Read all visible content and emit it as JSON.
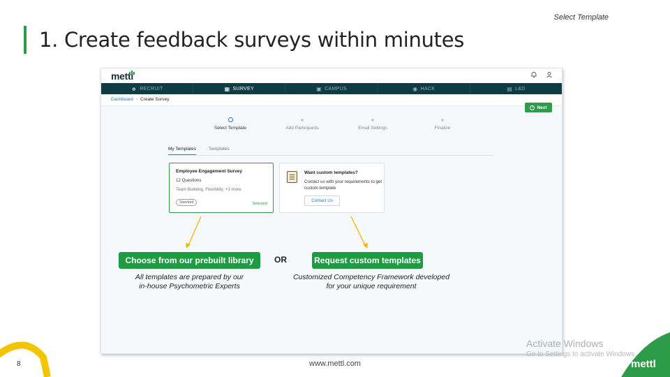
{
  "slide": {
    "top_label": "Select Template",
    "title": "1. Create feedback surveys within minutes",
    "page_number": "8",
    "footer_url": "www.mettl.com",
    "footer_logo": "mettl"
  },
  "app": {
    "logo": "mettl",
    "nav": [
      {
        "label": "RECRUIT",
        "icon": "people-icon"
      },
      {
        "label": "SURVEY",
        "icon": "clipboard-icon"
      },
      {
        "label": "CAMPUS",
        "icon": "building-icon"
      },
      {
        "label": "HACK",
        "icon": "code-icon"
      },
      {
        "label": "L&D",
        "icon": "book-icon"
      }
    ],
    "breadcrumb": {
      "root": "Dashboard",
      "current": "Create Survey"
    },
    "next_label": "Next",
    "steps": [
      "Select Template",
      "Add Participants",
      "Email Settings",
      "Finalize"
    ],
    "tabs": [
      "My Templates",
      "Templates"
    ],
    "template_card": {
      "title": "Employee Engagement Survey",
      "questions": "12 Questions",
      "tags": "Team Building, Flexibility, +3 more",
      "badge": "Standard",
      "status": "Selected"
    },
    "custom_card": {
      "title": "Want custom templates?",
      "body": "Contact us with your requirements to get custom template",
      "button": "Contact Us"
    }
  },
  "callouts": {
    "left_button": "Choose from our prebuilt library",
    "left_desc_line1": "All templates are prepared by our",
    "left_desc_line2": "in-house Psychometric Experts",
    "or": "OR",
    "right_button": "Request custom templates",
    "right_desc_line1": "Customized Competency Framework developed",
    "right_desc_line2": "for your unique requirement"
  },
  "watermark": {
    "line1": "Activate Windows",
    "line2": "Go to Settings to activate Windows."
  },
  "colors": {
    "brand_green": "#2e9b4a",
    "nav_dark": "#0e3b44",
    "arrow_yellow": "#f2b705",
    "link_blue": "#1f78b4"
  }
}
